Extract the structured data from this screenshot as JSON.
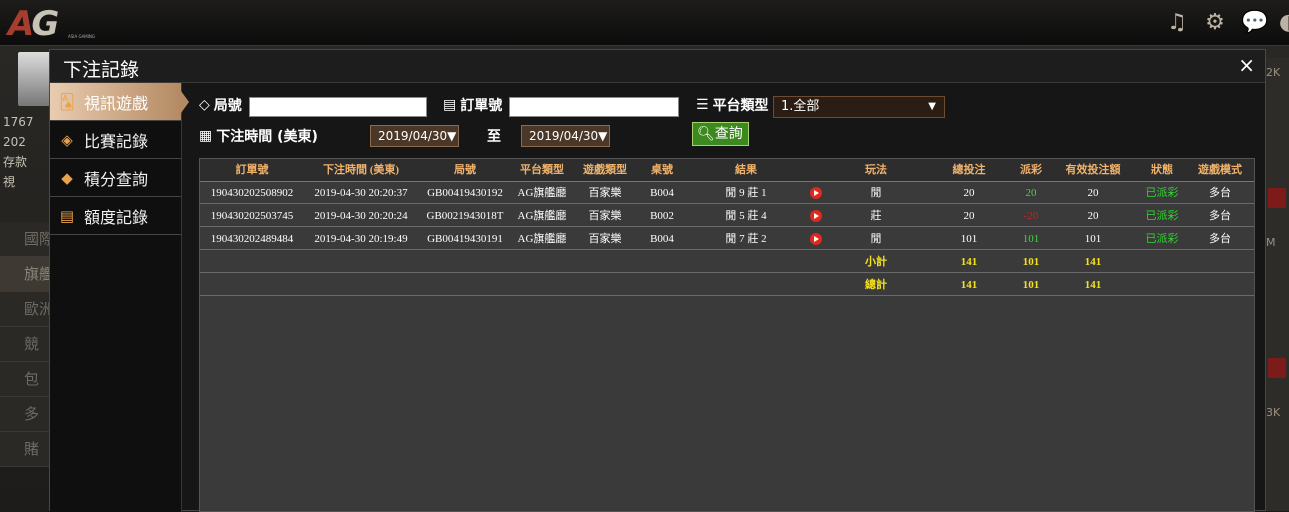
{
  "brand": {
    "logo": "AG",
    "logo_sub": "ASIA GAMING"
  },
  "top_icons": [
    "music-icon",
    "gear-icon",
    "chat-icon",
    "partial-icon"
  ],
  "background": {
    "side_info": [
      "1767",
      "202",
      "存款",
      "視"
    ],
    "nav_items": [
      "國際",
      "旗艦",
      "歐洲",
      "競",
      "包",
      "多",
      "賭"
    ],
    "right_labels": [
      "2K",
      "M",
      "3K"
    ]
  },
  "dialog": {
    "title": "下注記錄",
    "close": "×",
    "menu": [
      {
        "label": "視訊遊戲",
        "icon": "cards-icon",
        "active": true
      },
      {
        "label": "比賽記錄",
        "icon": "ticket-icon",
        "active": false
      },
      {
        "label": "積分查詢",
        "icon": "diamond-icon",
        "active": false
      },
      {
        "label": "額度記錄",
        "icon": "document-icon",
        "active": false
      }
    ],
    "filters": {
      "game_no_label": "局號",
      "order_no_label": "訂單號",
      "platform_label": "平台類型",
      "platform_value": "1.全部",
      "time_label": "下注時間 (美東)",
      "date_from": "2019/04/30",
      "to_label": "至",
      "date_to": "2019/04/30",
      "query_button": "查詢"
    },
    "table": {
      "headers": [
        "訂單號",
        "下注時間 (美東)",
        "局號",
        "平台類型",
        "遊戲類型",
        "桌號",
        "結果",
        "",
        "玩法",
        "總投注",
        "派彩",
        "有效投注額",
        "狀態",
        "遊戲模式"
      ],
      "rows": [
        [
          "190430202508902",
          "2019-04-30 20:20:37",
          "GB00419430192",
          "AG旗艦廳",
          "百家樂",
          "B004",
          "閒 9 莊 1",
          "",
          "閒",
          "20",
          "20",
          "20",
          "已派彩",
          "多台"
        ],
        [
          "190430202503745",
          "2019-04-30 20:20:24",
          "GB0021943018T",
          "AG旗艦廳",
          "百家樂",
          "B002",
          "閒 5 莊 4",
          "",
          "莊",
          "20",
          "-20",
          "20",
          "已派彩",
          "多台"
        ],
        [
          "190430202489484",
          "2019-04-30 20:19:49",
          "GB00419430191",
          "AG旗艦廳",
          "百家樂",
          "B004",
          "閒 7 莊 2",
          "",
          "閒",
          "101",
          "101",
          "101",
          "已派彩",
          "多台"
        ]
      ],
      "payout_colors": [
        "green",
        "red",
        "green"
      ],
      "subtotal": {
        "label": "小計",
        "total_bet": "141",
        "payout": "101",
        "valid_bet": "141"
      },
      "grandtotal": {
        "label": "總計",
        "total_bet": "141",
        "payout": "101",
        "valid_bet": "141"
      }
    }
  },
  "colors": {
    "accent": "#e9ccb0",
    "header_text": "#f0b26b",
    "positive": "#3dd73d",
    "negative": "#b02b2b",
    "total": "#f4e21f",
    "query_btn": "#3c8a1f"
  }
}
